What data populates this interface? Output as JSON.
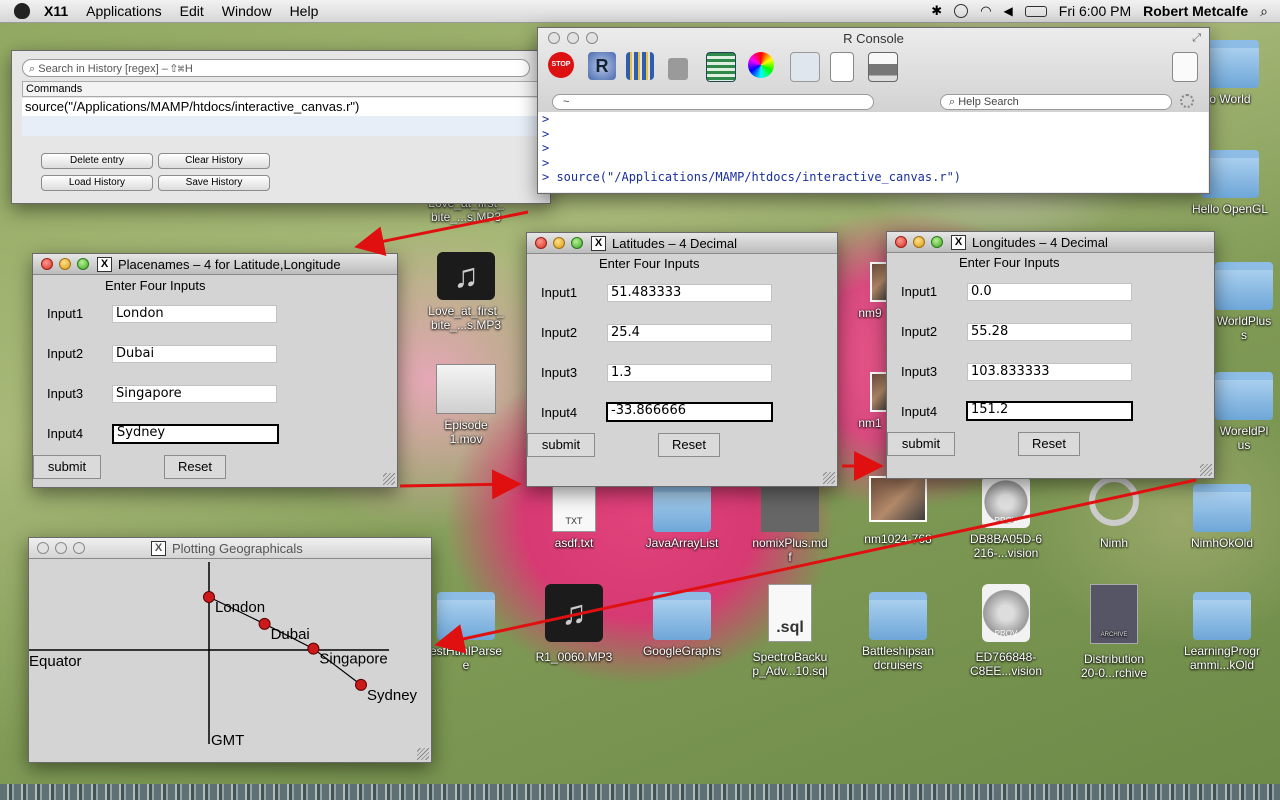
{
  "menubar": {
    "items": [
      "X11",
      "Applications",
      "Edit",
      "Window",
      "Help"
    ],
    "clock": "Fri 6:00 PM",
    "user": "Robert Metcalfe"
  },
  "history": {
    "search_placeholder": "Search in History [regex] – ⇧⌘H",
    "column_header": "Commands",
    "rows": [
      "source(\"/Applications/MAMP/htdocs/interactive_canvas.r\")"
    ],
    "buttons": {
      "delete": "Delete entry",
      "clear": "Clear History",
      "load": "Load History",
      "save": "Save History"
    }
  },
  "rconsole": {
    "title": "R Console",
    "path": "~",
    "help_placeholder": "Help Search",
    "lines": [
      ">",
      ">",
      ">",
      ">",
      "> source(\"/Applications/MAMP/htdocs/interactive_canvas.r\")"
    ],
    "stop_label": "STOP"
  },
  "placenames": {
    "title": "Placenames – 4 for Latitude,Longitude",
    "heading": "Enter Four Inputs",
    "labels": [
      "Input1",
      "Input2",
      "Input3",
      "Input4"
    ],
    "values": [
      "London",
      "Dubai",
      "Singapore",
      "Sydney"
    ],
    "submit": "submit",
    "reset": "Reset"
  },
  "latitudes": {
    "title": "Latitudes – 4 Decimal",
    "heading": "Enter Four Inputs",
    "labels": [
      "Input1",
      "Input2",
      "Input3",
      "Input4"
    ],
    "values": [
      "51.483333",
      "25.4",
      "1.3",
      "-33.866666"
    ],
    "submit": "submit",
    "reset": "Reset"
  },
  "longitudes": {
    "title": "Longitudes – 4 Decimal",
    "heading": "Enter Four Inputs",
    "labels": [
      "Input1",
      "Input2",
      "Input3",
      "Input4"
    ],
    "values": [
      "0.0",
      "55.28",
      "103.833333",
      "151.2"
    ],
    "submit": "submit",
    "reset": "Reset"
  },
  "plot": {
    "title": "Plotting Geographicals",
    "equator_label": "Equator",
    "gmt_label": "GMT",
    "points": [
      {
        "name": "London",
        "lat": 51.483333,
        "lon": 0.0
      },
      {
        "name": "Dubai",
        "lat": 25.4,
        "lon": 55.28
      },
      {
        "name": "Singapore",
        "lat": 1.3,
        "lon": 103.833333
      },
      {
        "name": "Sydney",
        "lat": -33.866666,
        "lon": 151.2
      }
    ],
    "point_color": "#cc1a1a"
  },
  "desktop": {
    "icons": {
      "hello_world": "o World",
      "hello_opengl": "Hello OpenGL",
      "worldplus": "WorldPlus\ns",
      "worldpl": "WoreldPl\nus",
      "love1": "Love_at_first_\nbite_...s.MP3",
      "love2": "Love_at_first_\nbite_...s.MP3",
      "episode": "Episode\n1.mov",
      "nm9": "nm9",
      "nm1": "nm1",
      "asdf": "asdf.txt",
      "java": "JavaArrayList",
      "nomix": "nomixPlus.md\nf",
      "nm1024": "nm1024-768",
      "db8": "DB8BA05D-6\n216-...vision",
      "nimh": "Nimh",
      "nimhok": "NimhOkOld",
      "esthtml": "estHtmlParse\ne",
      "r1": "R1_0060.MP3",
      "gg": "GoogleGraphs",
      "spectro": "SpectroBacku\np_Adv...10.sql",
      "battle": "Battleshipsan\ndcruisers",
      "ed7": "ED766848-\nC8EE...vision",
      "distrib": "Distribution\n20-0...rchive",
      "learning": "LearningProgr\nammi...kOld",
      "txt_badge": "TXT",
      "sql_badge": ".sql",
      "prov_badge": "PROV",
      "archive_badge": "ARCHIVE"
    }
  }
}
